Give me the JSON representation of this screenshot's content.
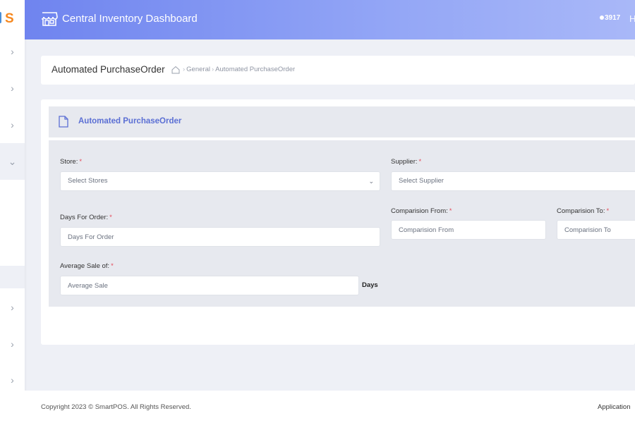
{
  "header": {
    "title": "Central Inventory Dashboard",
    "badge_count": "3917",
    "user_initial": "H"
  },
  "sidebar": {
    "logo_letter": "S",
    "items": [
      {
        "icon": "chevron-right-icon",
        "glyph": "›"
      },
      {
        "icon": "chevron-right-icon",
        "glyph": "›"
      },
      {
        "icon": "chevron-right-icon",
        "glyph": "›"
      },
      {
        "icon": "chevron-down-icon",
        "glyph": "⌄"
      },
      {
        "icon": "chevron-right-icon",
        "glyph": "›"
      },
      {
        "icon": "chevron-right-icon",
        "glyph": "›"
      },
      {
        "icon": "chevron-right-icon",
        "glyph": "›"
      }
    ]
  },
  "breadcrumb": {
    "title": "Automated PurchaseOrder",
    "trail": [
      "General",
      "Automated PurchaseOrder"
    ]
  },
  "panel": {
    "title": "Automated PurchaseOrder"
  },
  "form": {
    "store": {
      "label": "Store:",
      "required": "*",
      "value": "Select Stores"
    },
    "supplier": {
      "label": "Supplier:",
      "required": "*",
      "value": "Select Supplier"
    },
    "days_for_order": {
      "label": "Days For Order:",
      "required": "*",
      "placeholder": "Days For Order"
    },
    "comparision_from": {
      "label": "Comparision From:",
      "required": "*",
      "placeholder": "Comparision From"
    },
    "comparision_to": {
      "label": "Comparision To:",
      "required": "*",
      "placeholder": "Comparision To"
    },
    "average_sale": {
      "label": "Average Sale of:",
      "required": "*",
      "placeholder": "Average Sale",
      "suffix": "Days"
    }
  },
  "footer": {
    "copyright": "Copyright 2023 © SmartPOS. All Rights Reserved.",
    "app_text": "Application"
  },
  "colors": {
    "header_start": "#6f84ef",
    "header_end": "#a9b8f8",
    "accent": "#5b6fd4",
    "required": "#e44b5a",
    "logo": "#f6881f"
  }
}
